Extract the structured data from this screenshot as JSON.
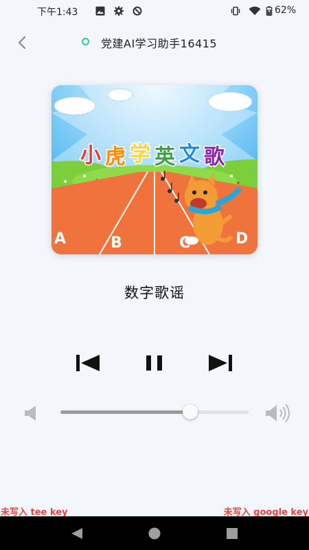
{
  "status_bar": {
    "time": "下午1:43",
    "battery": "62%",
    "icons": [
      "image-icon",
      "gear-icon",
      "data-saver-icon",
      "vibrate-icon",
      "wifi-icon",
      "battery-icon"
    ]
  },
  "header": {
    "title": "党建AI学习助手16415",
    "back_icon": "chevron-left-icon",
    "online_color": "#2ecc8a"
  },
  "album": {
    "cover_text": [
      "小",
      "虎",
      "学",
      "英",
      "文",
      "歌"
    ],
    "cover_text_colors": [
      "#e53935",
      "#fb8c00",
      "#fdd835",
      "#43a047",
      "#1e88e5",
      "#8e24aa"
    ],
    "track_letters": [
      "A",
      "B",
      "C",
      "D"
    ]
  },
  "player": {
    "song_title": "数字歌谣",
    "volume_level": 0.69
  },
  "debug": {
    "left": "未写入 tee key",
    "right": "未写入 google key"
  },
  "nav": {
    "buttons": [
      "back-triangle-icon",
      "home-circle-icon",
      "recents-square-icon"
    ]
  }
}
